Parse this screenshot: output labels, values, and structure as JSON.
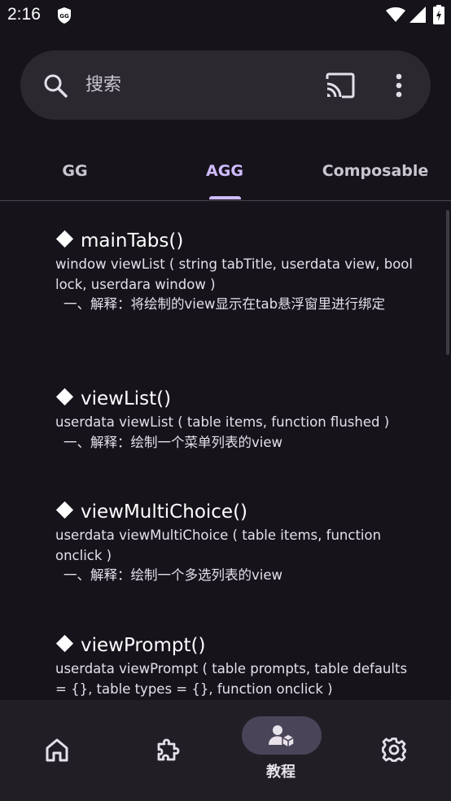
{
  "status_bar": {
    "time": "2:16",
    "app_icon": "gg-shield-icon",
    "icons": [
      "wifi-icon",
      "signal-icon",
      "battery-icon"
    ]
  },
  "search": {
    "placeholder": "搜索",
    "icons": [
      "search-icon",
      "cast-icon",
      "more-vert-icon"
    ]
  },
  "tabs": [
    {
      "label": "GG"
    },
    {
      "label": "AGG",
      "selected": true
    },
    {
      "label": "Composable"
    }
  ],
  "entries": [
    {
      "title": "mainTabs()",
      "signature": "window viewList ( string tabTitle, userdata view, bool lock, userdara window )",
      "description": "一、解释：将绘制的view显示在tab悬浮窗里进行绑定"
    },
    {
      "title": "viewList()",
      "signature": "userdata viewList ( table items, function flushed )",
      "description": "一、解释：绘制一个菜单列表的view"
    },
    {
      "title": "viewMultiChoice()",
      "signature": "userdata viewMultiChoice ( table items, function onclick )",
      "description": "一、解释：绘制一个多选列表的view"
    },
    {
      "title": "viewPrompt()",
      "signature": "userdata viewPrompt ( table prompts, table defaults = {}, table types = {}, function onclick )",
      "description": ""
    }
  ],
  "bottom_nav": {
    "items": [
      {
        "icon": "home-icon",
        "label": ""
      },
      {
        "icon": "puzzle-icon",
        "label": ""
      },
      {
        "icon": "tutorial-icon",
        "label": "教程",
        "selected": true
      },
      {
        "icon": "settings-gear-icon",
        "label": ""
      }
    ]
  },
  "colors": {
    "background": "#16131a",
    "surface": "#2c2830",
    "accent": "#cfbcff",
    "nav_background": "#211e26",
    "nav_pill": "#4a4458"
  }
}
